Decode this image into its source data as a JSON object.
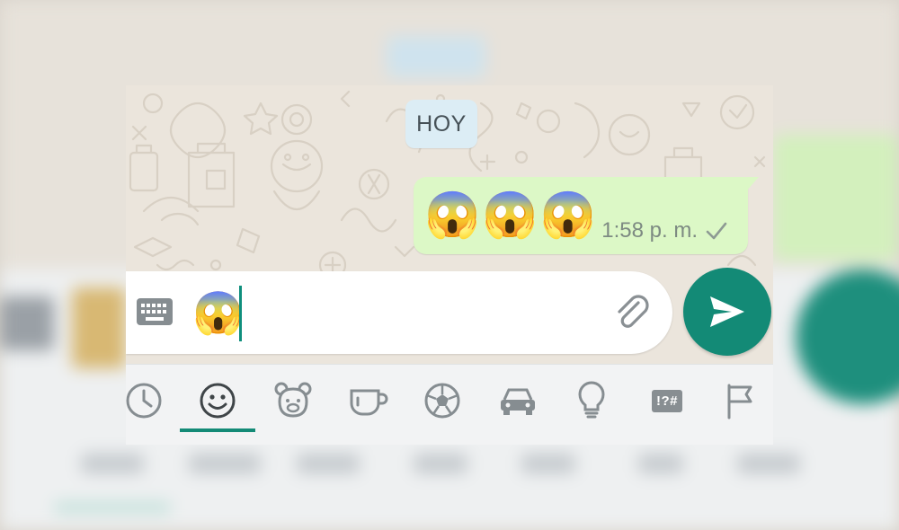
{
  "chat": {
    "date_chip": "HOY",
    "outgoing_message": {
      "emojis": "😱😱😱",
      "time": "1:58 p. m.",
      "status": "sent-single-check"
    }
  },
  "composer": {
    "input_value": "😱",
    "keyboard_icon": "keyboard-icon",
    "attach_icon": "paperclip-icon",
    "send_icon": "send-arrow-icon"
  },
  "emoji_tabs": {
    "active": "smileys",
    "items": [
      "recent",
      "smileys",
      "animals",
      "food",
      "activities",
      "travel",
      "objects",
      "symbols",
      "flags"
    ],
    "symbols_label": "!?#"
  },
  "colors": {
    "accent": "#138a76",
    "outgoing_bubble": "#dcf8c6",
    "date_chip": "#dcedf5",
    "wallpaper": "#ebe5dc"
  }
}
